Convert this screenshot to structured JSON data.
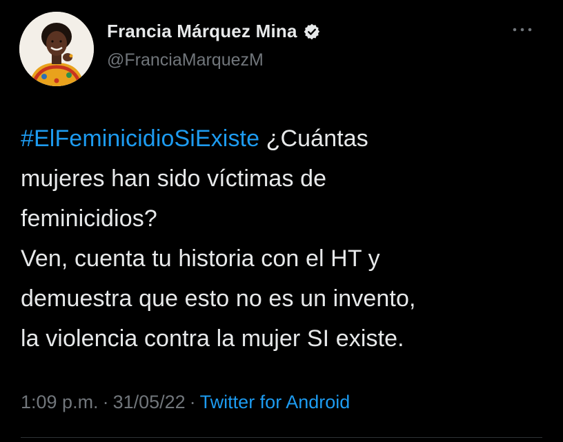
{
  "author": {
    "display_name": "Francia Márquez Mina",
    "handle": "@FranciaMarquezM",
    "verified": true,
    "avatar_icon": "profile-photo"
  },
  "tweet": {
    "hashtag": "#ElFeminicidioSiExiste",
    "lines": [
      " ¿Cuántas",
      "mujeres han sido víctimas de",
      "feminicidios?",
      "Ven, cuenta tu historia con el HT y",
      "demuestra que esto no es un invento,",
      "la violencia contra la mujer SI existe."
    ]
  },
  "meta": {
    "time": "1:09 p.m.",
    "separator": "·",
    "date": "31/05/22",
    "source": "Twitter for Android"
  },
  "icons": {
    "more": "more-options-icon",
    "verified": "verified-badge-icon"
  },
  "colors": {
    "background": "#000000",
    "text": "#e7e9ea",
    "secondary": "#71767b",
    "accent": "#1d9bf0"
  }
}
